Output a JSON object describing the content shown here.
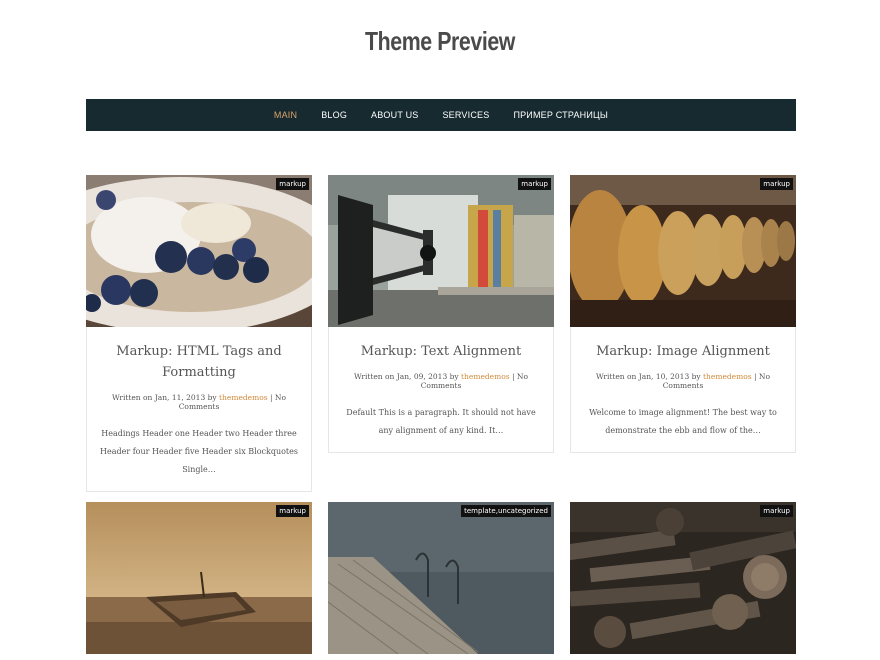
{
  "site": {
    "title": "Theme Preview"
  },
  "nav": {
    "items": [
      {
        "label": "Main",
        "active": true
      },
      {
        "label": "Blog"
      },
      {
        "label": "About Us"
      },
      {
        "label": "Services"
      },
      {
        "label": "Пример страницы"
      }
    ]
  },
  "posts": [
    {
      "tag": "markup",
      "title": "Markup: HTML Tags and Formatting",
      "written_prefix": "Written on Jan, 11, 2013 by",
      "author": "themedemos",
      "separator": "|",
      "comments": "No Comments",
      "excerpt": "Headings Header one Header two Header three Header four Header five Header six Blockquotes Single…",
      "image": "dessert-blueberries"
    },
    {
      "tag": "markup",
      "title": "Markup: Text Alignment",
      "written_prefix": "Written on Jan, 09, 2013 by",
      "author": "themedemos",
      "separator": "|",
      "comments": "No Comments",
      "excerpt": "Default This is a paragraph. It should not have any alignment of any kind. It…",
      "image": "vintage-camera"
    },
    {
      "tag": "markup",
      "title": "Markup: Image Alignment",
      "written_prefix": "Written on Jan, 10, 2013 by",
      "author": "themedemos",
      "separator": "|",
      "comments": "No Comments",
      "excerpt": "Welcome to image alignment! The best way to demonstrate the ebb and flow of the…",
      "image": "buddha-statues"
    },
    {
      "tag": "markup",
      "image": "boat-on-beach"
    },
    {
      "tag": "template,uncategorized",
      "image": "wooden-pier"
    },
    {
      "tag": "markup",
      "image": "firewood-logs"
    }
  ]
}
